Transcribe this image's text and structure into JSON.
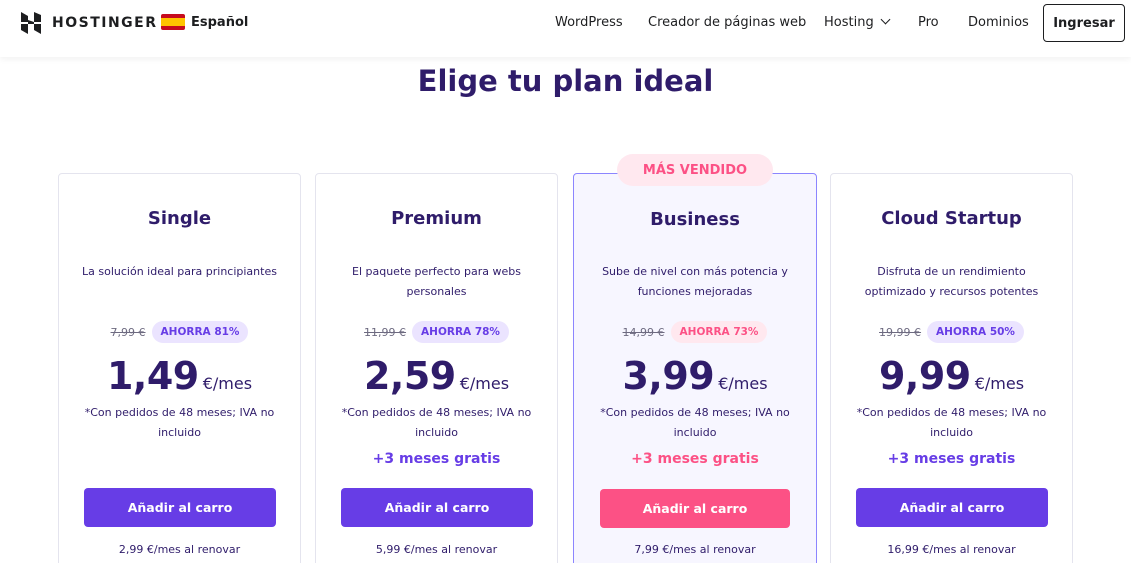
{
  "header": {
    "brand": "HOSTINGER",
    "language": "Español",
    "nav": [
      "WordPress",
      "Creador de páginas web",
      "Hosting",
      "Pro",
      "Dominios"
    ],
    "login": "Ingresar"
  },
  "title": "Elige tu plan ideal",
  "featured_badge": "MÁS VENDIDO",
  "plans": [
    {
      "name": "Single",
      "desc": "La solución ideal para principiantes",
      "old_price": "7,99 €",
      "save": "AHORRA 81%",
      "price": "1,49",
      "unit": "€/mes",
      "terms": "*Con pedidos de 48 meses; IVA no incluido",
      "bonus": "",
      "button": "Añadir al carro",
      "renew": "2,99 €/mes al renovar"
    },
    {
      "name": "Premium",
      "desc": "El paquete perfecto para webs personales",
      "old_price": "11,99 €",
      "save": "AHORRA 78%",
      "price": "2,59",
      "unit": "€/mes",
      "terms": "*Con pedidos de 48 meses; IVA no incluido",
      "bonus": "+3 meses gratis",
      "button": "Añadir al carro",
      "renew": "5,99 €/mes al renovar"
    },
    {
      "name": "Business",
      "desc": "Sube de nivel con más potencia y funciones mejoradas",
      "old_price": "14,99 €",
      "save": "AHORRA 73%",
      "price": "3,99",
      "unit": "€/mes",
      "terms": "*Con pedidos de 48 meses; IVA no incluido",
      "bonus": "+3 meses gratis",
      "button": "Añadir al carro",
      "renew": "7,99 €/mes al renovar"
    },
    {
      "name": "Cloud Startup",
      "desc": "Disfruta de un rendimiento optimizado y recursos potentes",
      "old_price": "19,99 €",
      "save": "AHORRA 50%",
      "price": "9,99",
      "unit": "€/mes",
      "terms": "*Con pedidos de 48 meses; IVA no incluido",
      "bonus": "+3 meses gratis",
      "button": "Añadir al carro",
      "renew": "16,99 €/mes al renovar"
    }
  ],
  "colors": {
    "primary": "#673de6",
    "accent": "#fc5185",
    "text": "#2f1c6a"
  }
}
